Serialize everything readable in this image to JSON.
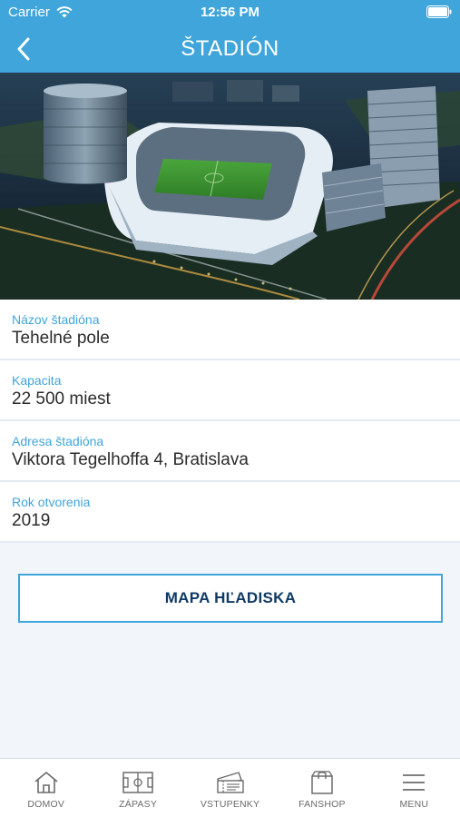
{
  "status_bar": {
    "carrier": "Carrier",
    "time": "12:56 PM"
  },
  "nav": {
    "title": "ŠTADIÓN"
  },
  "hero": {
    "image": "stadium-aerial-night-render"
  },
  "info": [
    {
      "label": "Názov štadióna",
      "value": "Tehelné pole"
    },
    {
      "label": "Kapacita",
      "value": "22 500 miest"
    },
    {
      "label": "Adresa štadióna",
      "value": "Viktora Tegelhoffa 4, Bratislava"
    },
    {
      "label": "Rok otvorenia",
      "value": "2019"
    }
  ],
  "map_button": {
    "label": "MAPA HĽADISKA"
  },
  "tabs": [
    {
      "label": "DOMOV",
      "icon": "house-icon"
    },
    {
      "label": "ZÁPASY",
      "icon": "pitch-icon"
    },
    {
      "label": "VSTUPENKY",
      "icon": "tickets-icon"
    },
    {
      "label": "FANSHOP",
      "icon": "bag-icon"
    },
    {
      "label": "MENU",
      "icon": "menu-icon"
    }
  ],
  "colors": {
    "accent": "#3fa5da",
    "button_text": "#0f3a66",
    "label": "#3fa5da",
    "background": "#f2f6fa"
  }
}
